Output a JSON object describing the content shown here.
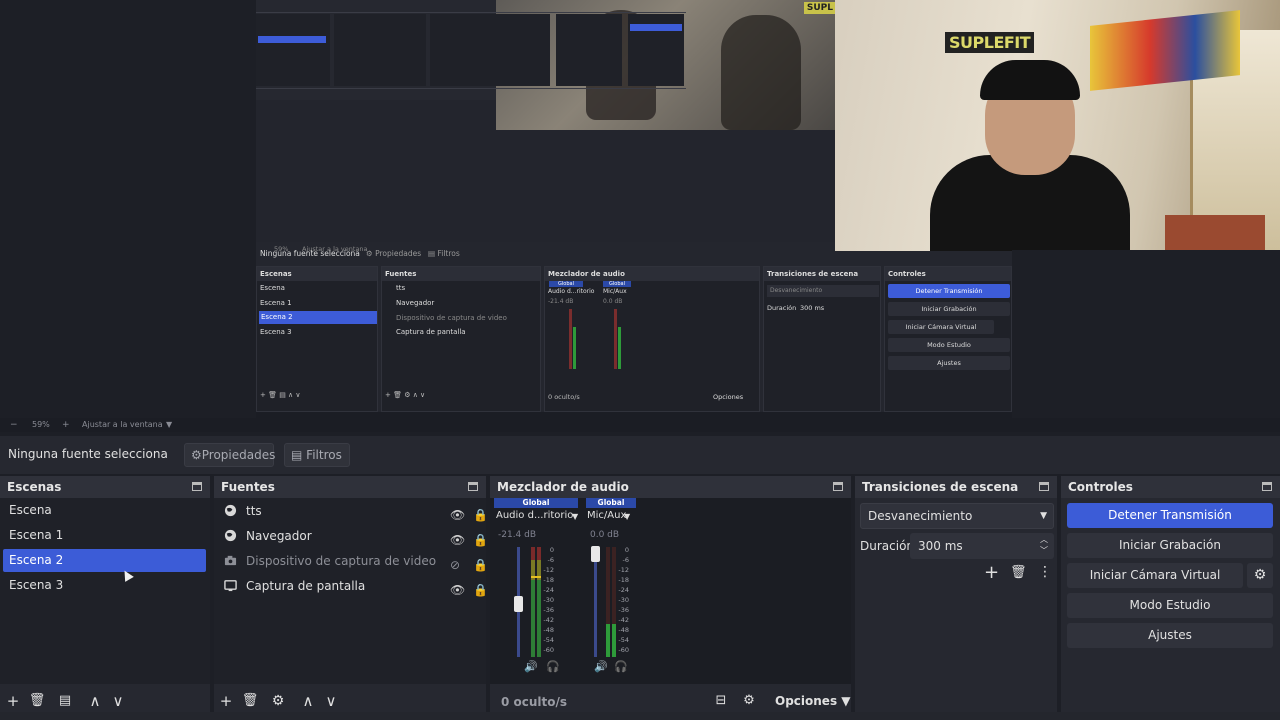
{
  "preview": {
    "zoom": "59%",
    "fit_label": "Ajustar a la ventana",
    "webcam_brand": "SUPLEFIT",
    "nested_brand": "SUPL"
  },
  "nested": {
    "no_source": "Ninguna fuente selecciona",
    "props": "Propiedades",
    "filters": "Filtros",
    "zoom": "59%",
    "fit_label": "Ajustar a la ventana",
    "scenes_title": "Escenas",
    "scenes": [
      "Escena",
      "Escena 1",
      "Escena 2",
      "Escena 3"
    ],
    "sources_title": "Fuentes",
    "sources": [
      "tts",
      "Navegador",
      "Dispositivo de captura de video",
      "Captura de pantalla"
    ],
    "mixer_title": "Mezclador de audio",
    "mixer_global": "Global",
    "mixer_ch1": "Audio d...ritorio",
    "mixer_ch2": "Mic/Aux",
    "mixer_db1": "-21.4 dB",
    "mixer_db2": "0.0 dB",
    "mixer_hidden": "0 oculto/s",
    "options": "Opciones",
    "transitions_title": "Transiciones de escena",
    "transition": "Desvanecimiento",
    "duration_label": "Duración",
    "duration": "300 ms",
    "controls_title": "Controles",
    "controls": [
      "Detener Transmisión",
      "Iniciar Grabación",
      "Iniciar Cámara Virtual",
      "Modo Estudio",
      "Ajustes"
    ]
  },
  "zoombar": {
    "minus": "−",
    "zoom": "59%",
    "plus": "+",
    "fit_label": "Ajustar a la ventana"
  },
  "source_toolbar": {
    "no_source": "Ninguna fuente selecciona",
    "properties": "Propiedades",
    "filters": "Filtros"
  },
  "scenes": {
    "title": "Escenas",
    "items": [
      "Escena",
      "Escena 1",
      "Escena 2",
      "Escena 3"
    ],
    "selected": "Escena 2"
  },
  "sources": {
    "title": "Fuentes",
    "items": [
      {
        "label": "tts",
        "icon": "globe-icon",
        "visible": true
      },
      {
        "label": "Navegador",
        "icon": "globe-icon",
        "visible": true
      },
      {
        "label": "Dispositivo de captura de video",
        "icon": "camera-icon",
        "visible": false
      },
      {
        "label": "Captura de pantalla",
        "icon": "monitor-icon",
        "visible": true
      }
    ]
  },
  "mixer": {
    "title": "Mezclador de audio",
    "channels": [
      {
        "global": "Global",
        "name": "Audio d...ritorio",
        "db": "-21.4 dB"
      },
      {
        "global": "Global",
        "name": "Mic/Aux",
        "db": "0.0 dB"
      }
    ],
    "scale": [
      "0",
      "-6",
      "-12",
      "-18",
      "-24",
      "-30",
      "-36",
      "-42",
      "-48",
      "-54",
      "-60"
    ],
    "hidden": "0 oculto/s",
    "options": "Opciones"
  },
  "transitions": {
    "title": "Transiciones de escena",
    "selected": "Desvanecimiento",
    "duration_label": "Duración",
    "duration": "300 ms"
  },
  "controls": {
    "title": "Controles",
    "stop_stream": "Detener Transmisión",
    "start_recording": "Iniciar Grabación",
    "start_virtual_cam": "Iniciar Cámara Virtual",
    "studio_mode": "Modo Estudio",
    "settings": "Ajustes"
  },
  "colors": {
    "accent": "#3c5cd7",
    "panel": "#262830",
    "dock_body": "#1f2128"
  }
}
